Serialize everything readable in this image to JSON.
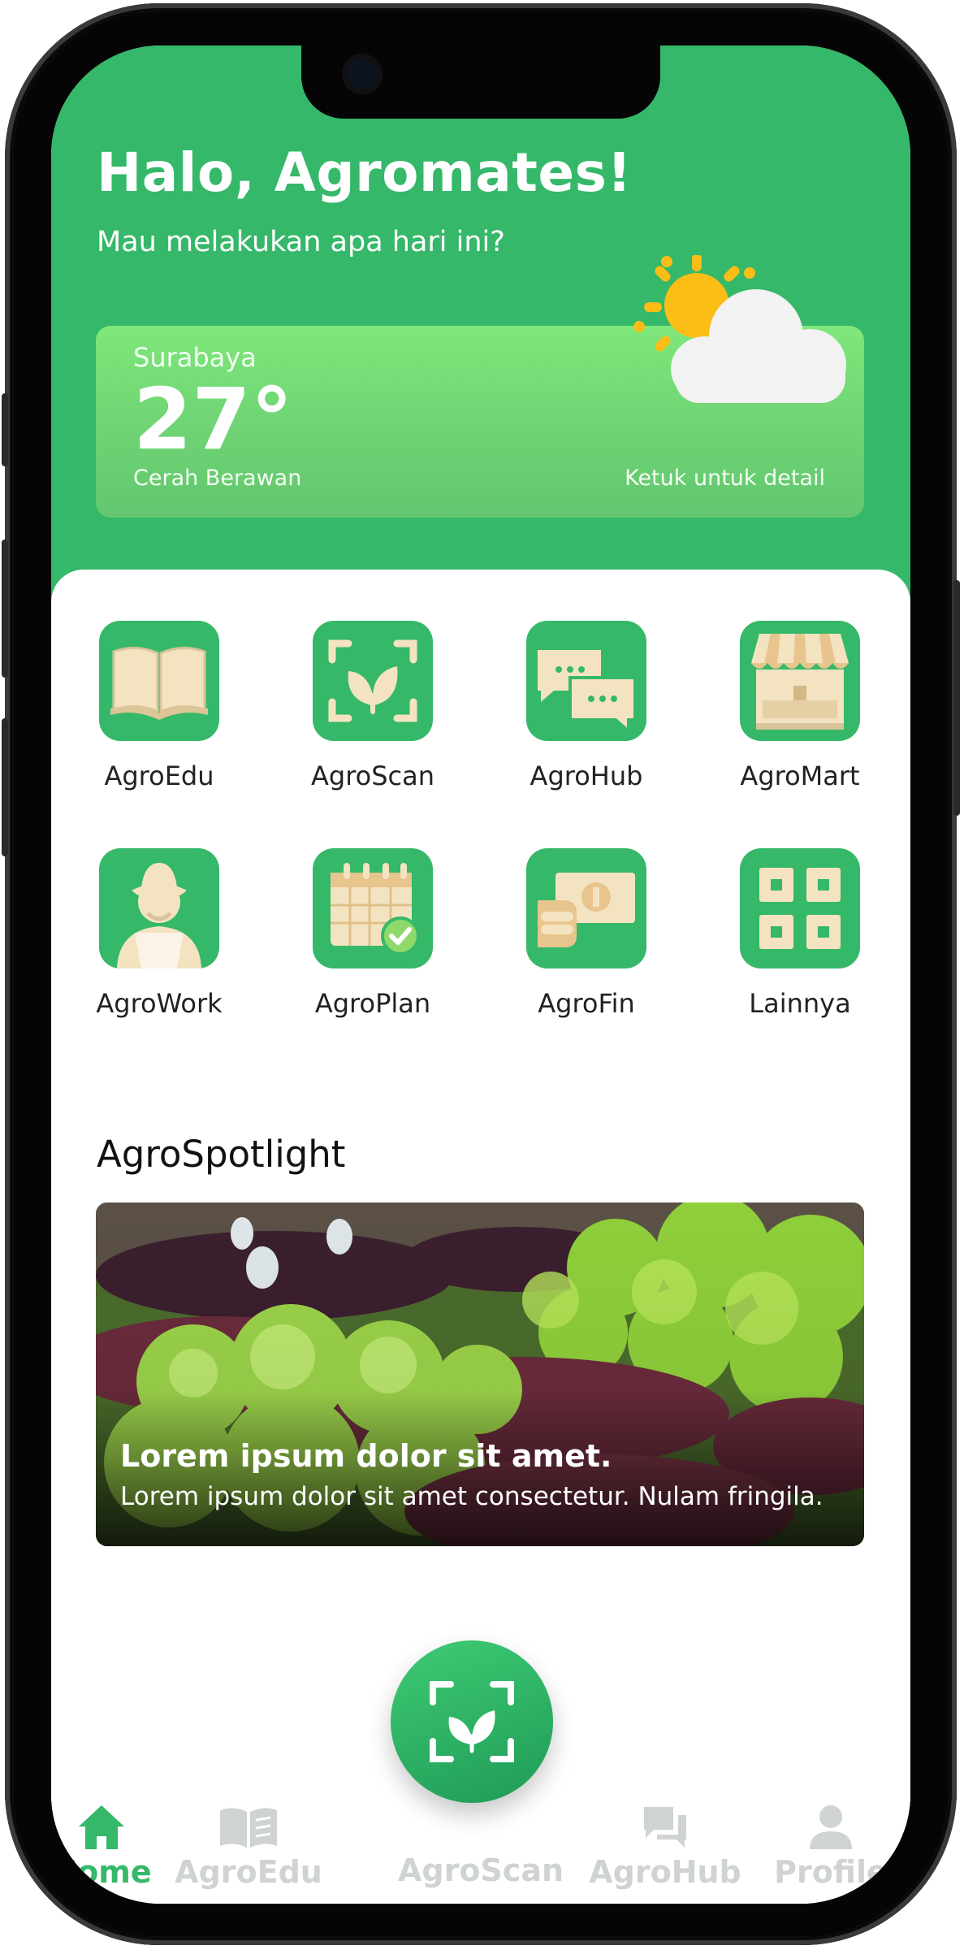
{
  "header": {
    "greeting": "Halo, Agromates!",
    "subtitle": "Mau melakukan apa hari ini?"
  },
  "weather": {
    "city": "Surabaya",
    "temperature": "27°",
    "condition": "Cerah Berawan",
    "tap_hint": "Ketuk untuk detail",
    "icon": "partly-cloudy-icon"
  },
  "menu": [
    {
      "label": "AgroEdu",
      "icon": "book-icon"
    },
    {
      "label": "AgroScan",
      "icon": "scan-leaf-icon"
    },
    {
      "label": "AgroHub",
      "icon": "chat-icon"
    },
    {
      "label": "AgroMart",
      "icon": "store-icon"
    },
    {
      "label": "AgroWork",
      "icon": "farmer-icon"
    },
    {
      "label": "AgroPlan",
      "icon": "calendar-check-icon"
    },
    {
      "label": "AgroFin",
      "icon": "money-icon"
    },
    {
      "label": "Lainnya",
      "icon": "grid-icon"
    }
  ],
  "spotlight": {
    "section_title": "AgroSpotlight",
    "headline": "Lorem ipsum dolor sit amet.",
    "description": "Lorem ipsum dolor sit amet consectetur. Nulam fringila."
  },
  "bottom_nav": [
    {
      "label": "Home",
      "icon": "home-icon",
      "active": true
    },
    {
      "label": "AgroEdu",
      "icon": "book-open-icon",
      "active": false
    },
    {
      "label": "AgroScan",
      "icon": "scan-leaf-icon",
      "active": false
    },
    {
      "label": "AgroHub",
      "icon": "chat-icon",
      "active": false
    },
    {
      "label": "Profile",
      "icon": "user-icon",
      "active": false
    }
  ],
  "colors": {
    "primary": "#35b869",
    "tile_cream": "#f4e3c0",
    "inactive": "#cfd3d1"
  }
}
